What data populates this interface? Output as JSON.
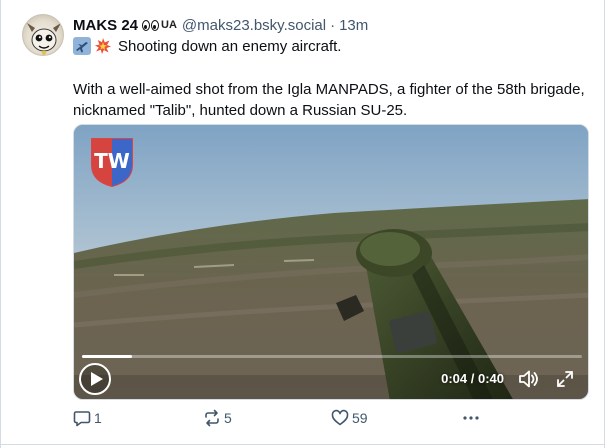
{
  "post": {
    "display_name": "MAKS 24",
    "name_suffix": "UA",
    "handle": "@maks23.bsky.social",
    "separator": "·",
    "time": "13m",
    "first_line": "Shooting down an enemy aircraft.",
    "first_line_icons": [
      "airplane-icon",
      "collision-icon"
    ],
    "body": "With a well-aimed shot from the Igla MANPADS, a fighter of the 58th brigade, nicknamed \"Talib\", hunted down a Russian SU-25."
  },
  "video": {
    "current_time": "0:04",
    "duration": "0:40",
    "time_separator": " / ",
    "progress": 0.1,
    "logo_letters": "TW"
  },
  "actions": {
    "replies": "1",
    "reposts": "5",
    "likes": "59",
    "more_icon": "ellipsis-icon"
  },
  "colors": {
    "text": "#0b0f14",
    "muted": "#42576c",
    "border": "#d4dbe2"
  }
}
